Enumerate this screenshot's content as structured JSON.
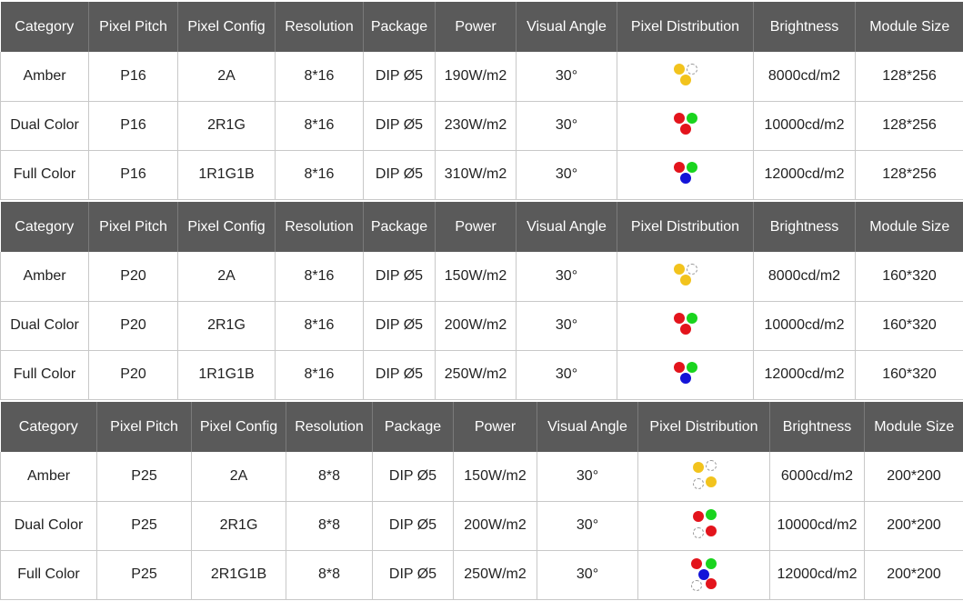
{
  "colors": {
    "header_bg": "#5a5a5a",
    "amber": "#f2c31d",
    "red": "#e3141c",
    "green": "#19d41e",
    "blue": "#1414d8",
    "empty": "#ffffff"
  },
  "tables": [
    {
      "headers": [
        "Category",
        "Pixel Pitch",
        "Pixel Config",
        "Resolution",
        "Package",
        "Power",
        "Visual Angle",
        "Pixel Distribution",
        "Brightness",
        "Module Size"
      ],
      "rows": [
        {
          "category": "Amber",
          "pitch": "P16",
          "config": "2A",
          "resolution": "8*16",
          "package": "DIP Ø5",
          "power": "190W/m2",
          "angle": "30°",
          "brightness": "8000cd/m2",
          "module": "128*256",
          "pixels": [
            "amber",
            "empty",
            "amber"
          ]
        },
        {
          "category": "Dual Color",
          "pitch": "P16",
          "config": "2R1G",
          "resolution": "8*16",
          "package": "DIP Ø5",
          "power": "230W/m2",
          "angle": "30°",
          "brightness": "10000cd/m2",
          "module": "128*256",
          "pixels": [
            "red",
            "green",
            "red"
          ]
        },
        {
          "category": "Full Color",
          "pitch": "P16",
          "config": "1R1G1B",
          "resolution": "8*16",
          "package": "DIP Ø5",
          "power": "310W/m2",
          "angle": "30°",
          "brightness": "12000cd/m2",
          "module": "128*256",
          "pixels": [
            "red",
            "green",
            "blue"
          ]
        }
      ]
    },
    {
      "headers": [
        "Category",
        "Pixel Pitch",
        "Pixel Config",
        "Resolution",
        "Package",
        "Power",
        "Visual Angle",
        "Pixel Distribution",
        "Brightness",
        "Module Size"
      ],
      "rows": [
        {
          "category": "Amber",
          "pitch": "P20",
          "config": "2A",
          "resolution": "8*16",
          "package": "DIP Ø5",
          "power": "150W/m2",
          "angle": "30°",
          "brightness": "8000cd/m2",
          "module": "160*320",
          "pixels": [
            "amber",
            "empty",
            "amber"
          ]
        },
        {
          "category": "Dual Color",
          "pitch": "P20",
          "config": "2R1G",
          "resolution": "8*16",
          "package": "DIP Ø5",
          "power": "200W/m2",
          "angle": "30°",
          "brightness": "10000cd/m2",
          "module": "160*320",
          "pixels": [
            "red",
            "green",
            "red"
          ]
        },
        {
          "category": "Full Color",
          "pitch": "P20",
          "config": "1R1G1B",
          "resolution": "8*16",
          "package": "DIP Ø5",
          "power": "250W/m2",
          "angle": "30°",
          "brightness": "12000cd/m2",
          "module": "160*320",
          "pixels": [
            "red",
            "green",
            "blue"
          ]
        }
      ]
    },
    {
      "headers": [
        "Category",
        "Pixel Pitch",
        "Pixel Config",
        "Resolution",
        "Package",
        "Power",
        "Visual Angle",
        "Pixel Distribution",
        "Brightness",
        "Module Size"
      ],
      "rows": [
        {
          "category": "Amber",
          "pitch": "P25",
          "config": "2A",
          "resolution": "8*8",
          "package": "DIP Ø5",
          "power": "150W/m2",
          "angle": "30°",
          "brightness": "6000cd/m2",
          "module": "200*200",
          "pixels": [
            "amber",
            "empty",
            "empty",
            "amber"
          ]
        },
        {
          "category": "Dual Color",
          "pitch": "P25",
          "config": "2R1G",
          "resolution": "8*8",
          "package": "DIP Ø5",
          "power": "200W/m2",
          "angle": "30°",
          "brightness": "10000cd/m2",
          "module": "200*200",
          "pixels": [
            "red",
            "green",
            "empty",
            "red"
          ]
        },
        {
          "category": "Full Color",
          "pitch": "P25",
          "config": "2R1G1B",
          "resolution": "8*8",
          "package": "DIP Ø5",
          "power": "250W/m2",
          "angle": "30°",
          "brightness": "12000cd/m2",
          "module": "200*200",
          "pixels": [
            "red",
            "green",
            "blue",
            "empty",
            "red"
          ]
        }
      ]
    }
  ]
}
